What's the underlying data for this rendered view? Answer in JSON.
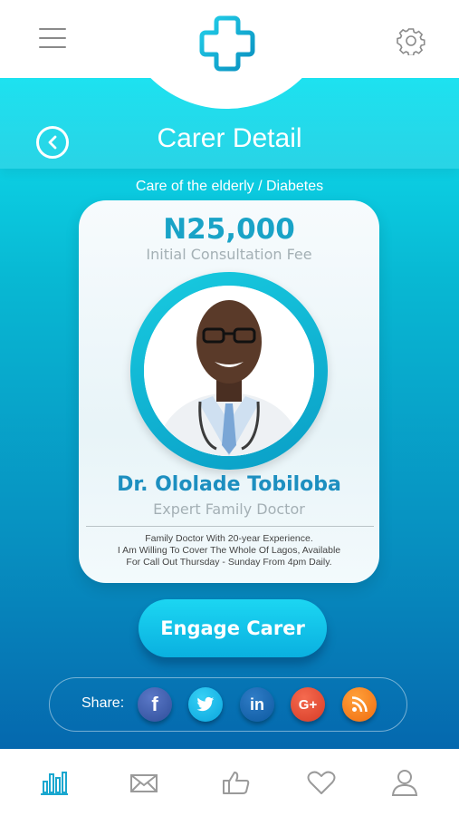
{
  "header": {
    "menu_icon": "hamburger-menu-icon",
    "logo_icon": "medical-cross-logo-icon",
    "settings_icon": "gear-icon"
  },
  "page": {
    "title": "Carer Detail",
    "subtitle": "Care of the elderly / Diabetes",
    "back_icon": "chevron-left-circle-icon"
  },
  "card": {
    "fee": "N25,000",
    "fee_label": "Initial Consultation Fee",
    "name": "Dr. Ololade Tobiloba",
    "role": "Expert Family Doctor",
    "bio_lines": [
      "Family Doctor With 20-year Experience.",
      "I Am Willing To Cover The Whole Of Lagos, Available",
      "For Call Out Thursday - Sunday From 4pm Daily."
    ]
  },
  "actions": {
    "engage_label": "Engage Carer"
  },
  "share": {
    "label": "Share:",
    "networks": [
      {
        "icon": "facebook-icon",
        "glyph": "f",
        "color": "#3b5998"
      },
      {
        "icon": "twitter-icon",
        "glyph": "",
        "color": "#1db7ea"
      },
      {
        "icon": "linkedin-icon",
        "glyph": "in",
        "color": "#0e68b5"
      },
      {
        "icon": "google-plus-icon",
        "glyph": "G+",
        "color": "#e0452f"
      },
      {
        "icon": "rss-icon",
        "glyph": "",
        "color": "#f67f1d"
      }
    ]
  },
  "bottom_nav": {
    "items": [
      "stats-icon",
      "mail-icon",
      "thumbs-up-icon",
      "heart-icon",
      "profile-icon"
    ],
    "active": "stats-icon",
    "active_color": "#1aa7cf",
    "inactive_color": "#9a9a9a"
  }
}
